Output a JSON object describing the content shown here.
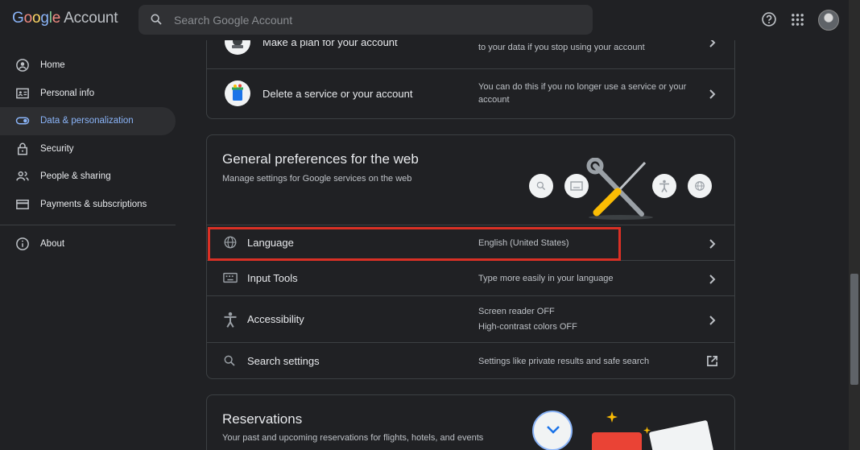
{
  "header": {
    "logo_letters": [
      "G",
      "o",
      "o",
      "g",
      "l",
      "e"
    ],
    "logo_suffix": "Account",
    "search_placeholder": "Search Google Account",
    "icons": [
      "search-icon",
      "help-icon",
      "apps-grid-icon",
      "account-avatar"
    ]
  },
  "sidebar": {
    "items": [
      {
        "label": "Home",
        "icon": "home-icon"
      },
      {
        "label": "Personal info",
        "icon": "id-card-icon"
      },
      {
        "label": "Data & personalization",
        "icon": "toggle-icon",
        "active": true
      },
      {
        "label": "Security",
        "icon": "lock-icon"
      },
      {
        "label": "People & sharing",
        "icon": "people-icon"
      },
      {
        "label": "Payments & subscriptions",
        "icon": "credit-card-icon"
      }
    ],
    "about_label": "About"
  },
  "card_account": {
    "rows": [
      {
        "label": "Make a plan for your account",
        "desc_top": "to your data if you stop using your account"
      },
      {
        "label": "Delete a service or your account",
        "desc": "You can do this if you no longer use a service or your account"
      }
    ]
  },
  "card_general": {
    "title": "General preferences for the web",
    "subtitle": "Manage settings for Google services on the web",
    "rows": [
      {
        "label": "Language",
        "desc": "English (United States)",
        "icon": "globe-icon"
      },
      {
        "label": "Input Tools",
        "desc": "Type more easily in your language",
        "icon": "keyboard-icon"
      },
      {
        "label": "Accessibility",
        "desc_line1": "Screen reader OFF",
        "desc_line2": "High-contrast colors OFF",
        "icon": "accessibility-icon"
      },
      {
        "label": "Search settings",
        "desc": "Settings like private results and safe search",
        "icon": "search-icon"
      }
    ]
  },
  "card_reservations": {
    "title": "Reservations",
    "subtitle": "Your past and upcoming reservations for flights, hotels, and events"
  },
  "colors": {
    "background": "#202124",
    "accent": "#8ab4f8",
    "highlight_box": "#d93025"
  }
}
